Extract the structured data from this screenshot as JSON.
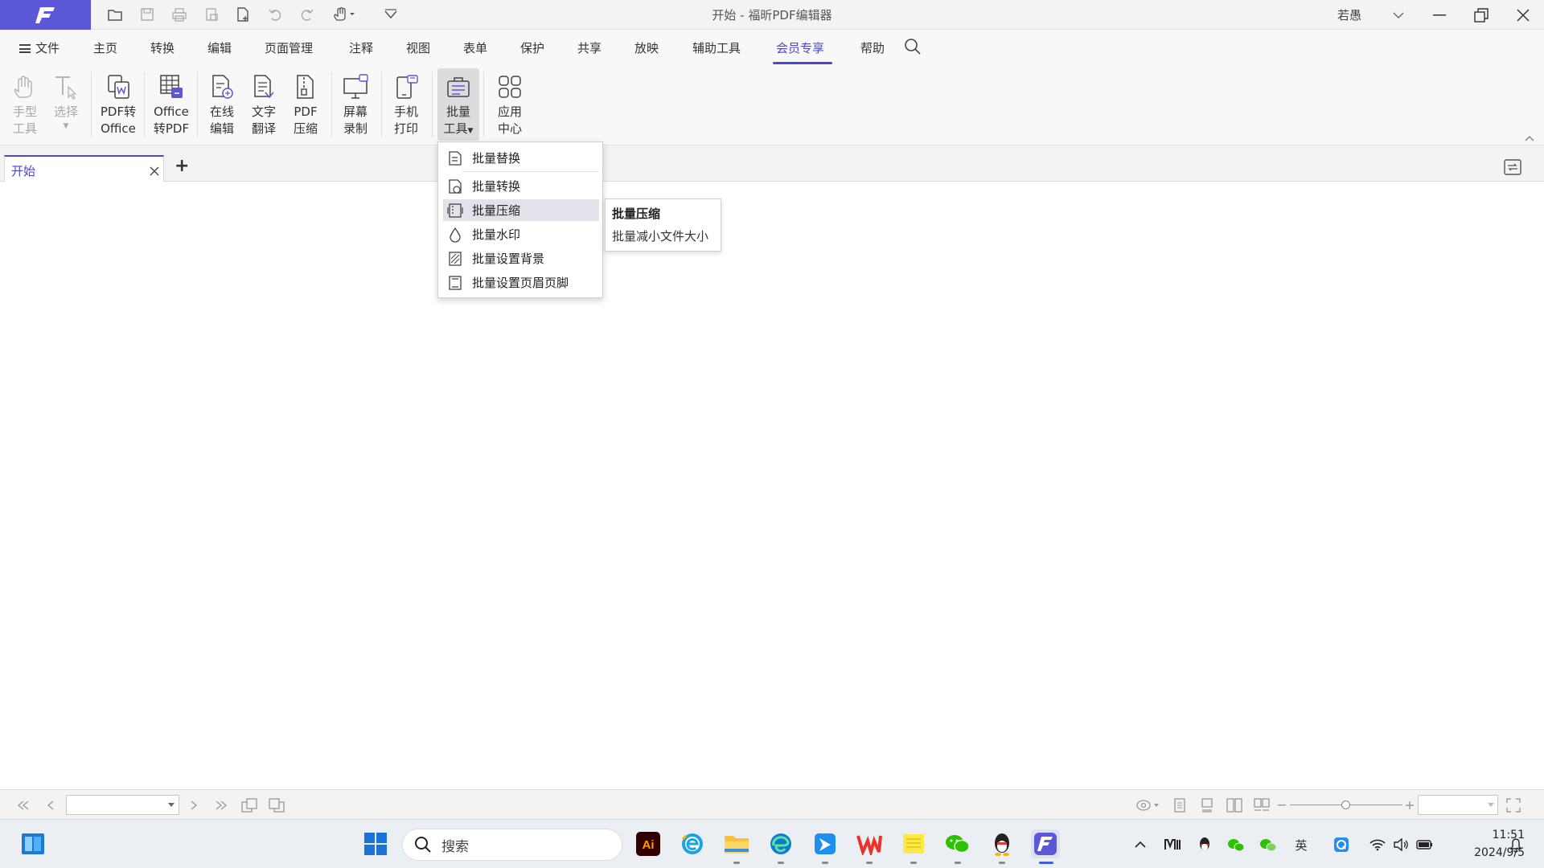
{
  "window": {
    "title": "开始 - 福昕PDF编辑器",
    "user": "若愚",
    "brand_color": "#5b57d6",
    "accent_color": "#4b47d2"
  },
  "menu": {
    "file": "文件",
    "items": [
      "主页",
      "转换",
      "编辑",
      "页面管理",
      "注释",
      "视图",
      "表单",
      "保护",
      "共享",
      "放映",
      "辅助工具",
      "会员专享",
      "帮助"
    ],
    "active": "会员专享"
  },
  "ribbon": {
    "hand_tool": [
      "手型",
      "工具"
    ],
    "select": [
      "选择"
    ],
    "pdf_to_office": [
      "PDF转",
      "Office"
    ],
    "office_to_pdf": [
      "Office",
      "转PDF"
    ],
    "online_edit": [
      "在线",
      "编辑"
    ],
    "translate": [
      "文字",
      "翻译"
    ],
    "pdf_compress": [
      "PDF",
      "压缩"
    ],
    "screen_record": [
      "屏幕",
      "录制"
    ],
    "mobile_print": [
      "手机",
      "打印"
    ],
    "batch_tools": [
      "批量",
      "工具"
    ],
    "app_center": [
      "应用",
      "中心"
    ]
  },
  "tabs": {
    "doc_tab": "开始",
    "new_tab": "+"
  },
  "dropdown": {
    "items": [
      "批量替换",
      "批量转换",
      "批量压缩",
      "批量水印",
      "批量设置背景",
      "批量设置页眉页脚"
    ],
    "highlighted": "批量压缩"
  },
  "tooltip": {
    "title": "批量压缩",
    "desc": "批量减小文件大小"
  },
  "status": {
    "page_value": "",
    "zoom_value": ""
  },
  "taskbar": {
    "search_placeholder": "搜索",
    "time": "11:51",
    "date": "2024/9/5"
  }
}
